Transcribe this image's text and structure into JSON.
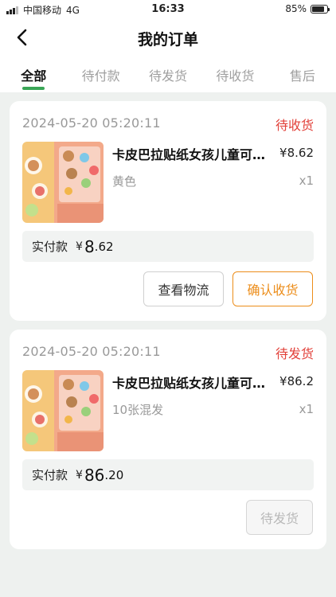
{
  "status_bar": {
    "carrier": "中国移动",
    "network": "4G",
    "time": "16:33",
    "battery": "85%",
    "battery_level": 0.85
  },
  "header": {
    "title": "我的订单",
    "back_icon": "chevron-left-icon"
  },
  "tabs": [
    {
      "label": "全部",
      "active": true
    },
    {
      "label": "待付款",
      "active": false
    },
    {
      "label": "待发货",
      "active": false
    },
    {
      "label": "待收货",
      "active": false
    },
    {
      "label": "售后",
      "active": false
    }
  ],
  "colors": {
    "accent_green": "#3aa657",
    "status_red": "#e2413a",
    "confirm_orange": "#ec8d1a",
    "background": "#eef1ef"
  },
  "orders": [
    {
      "time": "2024-05-20   05:20:11",
      "status": "待收货",
      "product_name": "卡皮巴拉贴纸女孩儿童可爱卡通贴纸",
      "price": "¥8.62",
      "spec": "黄色",
      "qty": "x1",
      "paid_label": "实付款",
      "paid_currency": "¥",
      "paid_int": "8",
      "paid_dec": ".62",
      "buttons": {
        "logistics": "查看物流",
        "confirm": "确认收货"
      }
    },
    {
      "time": "2024-05-20   05:20:11",
      "status": "待发货",
      "product_name": "卡皮巴拉贴纸女孩儿童可爱卡通贴纸",
      "price": "¥86.2",
      "spec": "10张混发",
      "qty": "x1",
      "paid_label": "实付款",
      "paid_currency": "¥",
      "paid_int": "86",
      "paid_dec": ".20",
      "buttons": {
        "pending": "待发货"
      }
    }
  ]
}
